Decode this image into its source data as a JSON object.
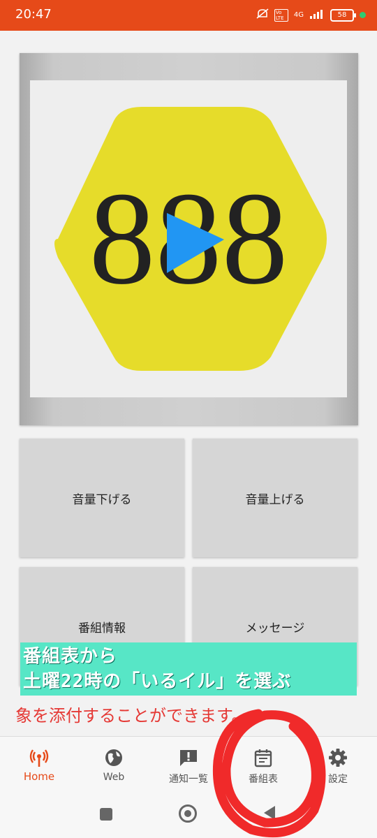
{
  "status_bar": {
    "time": "20:47",
    "network": "4G",
    "volte": "Vo LTE",
    "battery": "58"
  },
  "player": {
    "artwork_text": "888",
    "artwork_color": "#e6dc2a",
    "play_color": "#2196f3"
  },
  "buttons": {
    "volume_down": "音量下げる",
    "volume_up": "音量上げる",
    "program_info": "番組情報",
    "message": "メッセージ"
  },
  "overlay": {
    "line1": "番組表から",
    "line2": "土曜22時の「いるイル」を選ぶ",
    "background": "#57e6c6"
  },
  "red_text": "象を添付することができます。",
  "bottom_nav": {
    "items": [
      {
        "label": "Home",
        "icon": "broadcast-icon",
        "active": true
      },
      {
        "label": "Web",
        "icon": "globe-icon"
      },
      {
        "label": "通知一覧",
        "icon": "alert-icon"
      },
      {
        "label": "番組表",
        "icon": "calendar-icon"
      },
      {
        "label": "設定",
        "icon": "gear-icon"
      }
    ],
    "accent": "#e64a19"
  }
}
